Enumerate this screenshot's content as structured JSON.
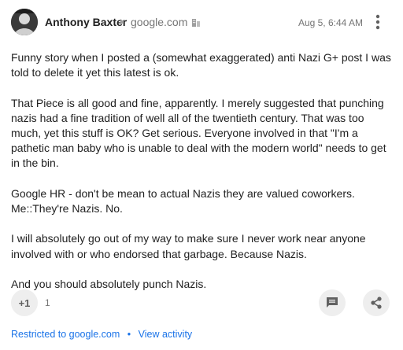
{
  "post": {
    "author": "Anthony Baxter",
    "community": "google.com",
    "timestamp": "Aug 5, 6:44 AM",
    "paragraphs": [
      "Funny story when I posted a (somewhat exaggerated) anti Nazi G+ post I was told to delete it yet this latest is ok.",
      "That Piece is all good and fine, apparently. I merely suggested that punching nazis had a fine tradition of well all of the twentieth century. That was too much, yet this stuff is OK? Get serious. Everyone involved in that \"I'm a pathetic man baby who is unable to deal with the modern world\" needs to get in the bin.",
      "Google HR - don't be mean to actual Nazis they are valued coworkers. Me::They're Nazis. No.",
      "I will absolutely go out of my way to make sure I never work near anyone involved with or who endorsed that garbage. Because Nazis.",
      "And you should absolutely punch Nazis."
    ]
  },
  "actions": {
    "plus_one_label": "+1",
    "plus_one_count": "1",
    "comment_icon": "comment-icon",
    "share_icon": "share-icon"
  },
  "footer": {
    "visibility_label": "Restricted to google.com",
    "separator": "•",
    "activity_label": "View activity"
  },
  "icons": {
    "avatar": "avatar",
    "community_arrow": "arrow-right-icon",
    "community_badge": "building-icon",
    "more": "more-vert-icon"
  },
  "colors": {
    "link": "#1a73e8",
    "secondary_text": "#757575",
    "button_bg": "#eeeeee"
  }
}
